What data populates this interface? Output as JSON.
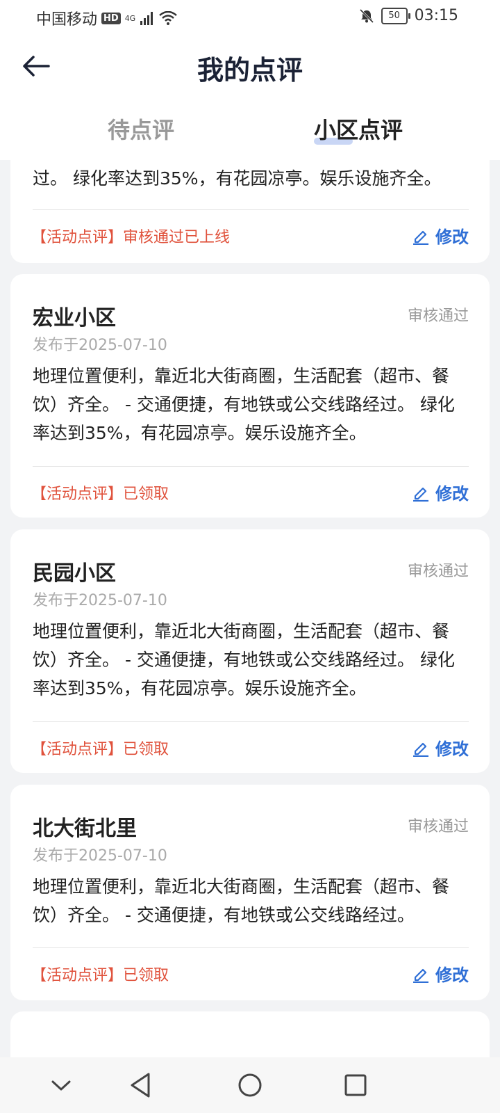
{
  "status_bar": {
    "carrier": "中国移动",
    "hd": "HD",
    "network": "4G",
    "battery": "50",
    "time": "03:15"
  },
  "header": {
    "title": "我的点评",
    "tabs": [
      {
        "label": "待点评"
      },
      {
        "label": "小区点评"
      }
    ]
  },
  "partial_card": {
    "body_tail": "过。 绿化率达到35%，有花园凉亭。娱乐设施齐全。",
    "tag": "【活动点评】审核通过已上线",
    "edit_label": "修改"
  },
  "cards": [
    {
      "name": "宏业小区",
      "status": "审核通过",
      "date": "发布于2025-07-10",
      "body": "地理位置便利，靠近北大街商圈，生活配套（超市、餐饮）齐全。 - 交通便捷，有地铁或公交线路经过。 绿化率达到35%，有花园凉亭。娱乐设施齐全。",
      "tag": "【活动点评】已领取",
      "edit_label": "修改"
    },
    {
      "name": "民园小区",
      "status": "审核通过",
      "date": "发布于2025-07-10",
      "body": "地理位置便利，靠近北大街商圈，生活配套（超市、餐饮）齐全。 - 交通便捷，有地铁或公交线路经过。 绿化率达到35%，有花园凉亭。娱乐设施齐全。",
      "tag": "【活动点评】已领取",
      "edit_label": "修改"
    },
    {
      "name": "北大街北里",
      "status": "审核通过",
      "date": "发布于2025-07-10",
      "body": "地理位置便利，靠近北大街商圈，生活配套（超市、餐饮）齐全。 - 交通便捷，有地铁或公交线路经过。",
      "tag": "【活动点评】已领取",
      "edit_label": "修改"
    }
  ],
  "colors": {
    "accent_blue": "#2f6fd6",
    "tag_red": "#e0523c",
    "page_bg": "#f2f3f5"
  }
}
